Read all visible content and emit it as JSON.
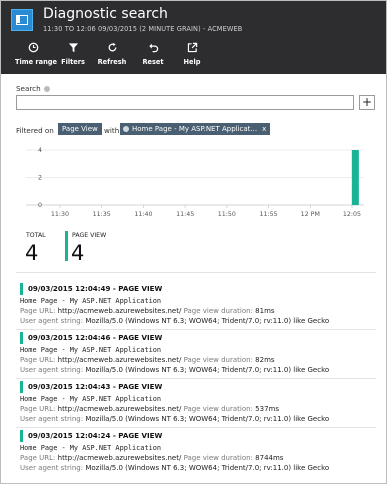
{
  "header": {
    "title": "Diagnostic search",
    "subtitle": "11:30 TO 12:06 09/03/2015 (2 MINUTE GRAIN) - ACMEWEB",
    "toolbar": [
      {
        "label": "Time range",
        "icon": "clock-icon"
      },
      {
        "label": "Filters",
        "icon": "funnel-icon"
      },
      {
        "label": "Refresh",
        "icon": "refresh-icon"
      },
      {
        "label": "Reset",
        "icon": "undo-icon"
      },
      {
        "label": "Help",
        "icon": "external-link-icon"
      }
    ]
  },
  "search": {
    "label": "Search",
    "value": "",
    "placeholder": "",
    "add_label": "+"
  },
  "filter": {
    "prefix": "Filtered on",
    "type_pill": "Page View",
    "with": "with",
    "page_pill": "Home Page - My ASP.NET Applicat...",
    "remove": "x"
  },
  "chart_data": {
    "type": "bar",
    "categories": [
      "11:30",
      "11:32",
      "11:34",
      "11:36",
      "11:38",
      "11:40",
      "11:42",
      "11:44",
      "11:46",
      "11:48",
      "11:50",
      "11:52",
      "11:54",
      "11:56",
      "11:58",
      "12:00",
      "12:02",
      "12:04"
    ],
    "values": [
      0,
      0,
      0,
      0,
      0,
      0,
      0,
      0,
      0,
      0,
      0,
      0,
      0,
      0,
      0,
      0,
      0,
      4
    ],
    "ylim": [
      0,
      4
    ],
    "yticks": [
      "4",
      "2",
      "0"
    ],
    "xticks": [
      "11:30",
      "11:35",
      "11:40",
      "11:45",
      "11:50",
      "11:55",
      "12 PM",
      "12:05"
    ],
    "grid": true,
    "color": "#19b395"
  },
  "totals": {
    "total_label": "TOTAL",
    "total_value": "4",
    "pageview_label": "PAGE VIEW",
    "pageview_value": "4"
  },
  "labels": {
    "page_url": "Page URL:",
    "duration": "Page view duration:",
    "user_agent": "User agent string:"
  },
  "events": [
    {
      "heading": "09/03/2015 12:04:49 - PAGE VIEW",
      "name": "Home Page - My ASP.NET Application",
      "url": "http://acmeweb.azurewebsites.net/",
      "duration": "81ms",
      "ua": "Mozilla/5.0 (Windows NT 6.3; WOW64; Trident/7.0; rv:11.0) like Gecko"
    },
    {
      "heading": "09/03/2015 12:04:46 - PAGE VIEW",
      "name": "Home Page - My ASP.NET Application",
      "url": "http://acmeweb.azurewebsites.net/",
      "duration": "82ms",
      "ua": "Mozilla/5.0 (Windows NT 6.3; WOW64; Trident/7.0; rv:11.0) like Gecko"
    },
    {
      "heading": "09/03/2015 12:04:43 - PAGE VIEW",
      "name": "Home Page - My ASP.NET Application",
      "url": "http://acmeweb.azurewebsites.net/",
      "duration": "537ms",
      "ua": "Mozilla/5.0 (Windows NT 6.3; WOW64; Trident/7.0; rv:11.0) like Gecko"
    },
    {
      "heading": "09/03/2015 12:04:24 - PAGE VIEW",
      "name": "Home Page - My ASP.NET Application",
      "url": "http://acmeweb.azurewebsites.net/",
      "duration": "8744ms",
      "ua": "Mozilla/5.0 (Windows NT 6.3; WOW64; Trident/7.0; rv:11.0) like Gecko"
    }
  ]
}
